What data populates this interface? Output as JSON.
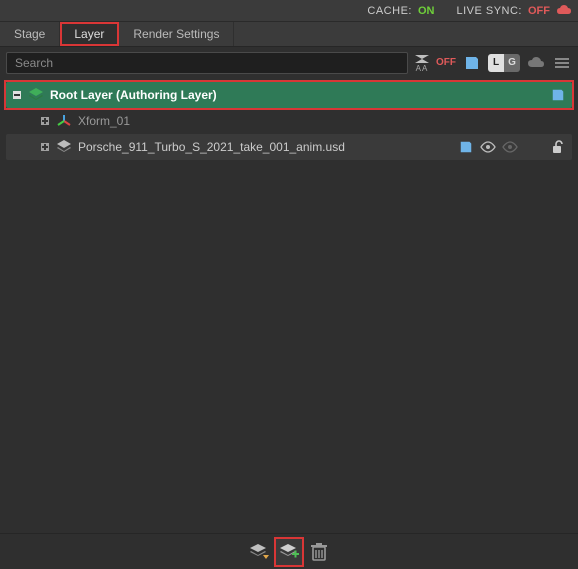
{
  "statusbar": {
    "cache_label": "CACHE:",
    "cache_status": "ON",
    "livesync_label": "LIVE SYNC:",
    "livesync_status": "OFF"
  },
  "tabs": [
    {
      "label": "Stage",
      "active": false
    },
    {
      "label": "Layer",
      "active": true,
      "highlighted": true
    },
    {
      "label": "Render Settings",
      "active": false
    }
  ],
  "toolbar": {
    "search_placeholder": "Search",
    "aa_label": "AA",
    "off_label": "OFF",
    "lg": [
      "L",
      "G"
    ]
  },
  "tree": {
    "root": {
      "label": "Root Layer (Authoring Layer)",
      "expanded": true,
      "highlighted": true,
      "actions": [
        "save"
      ]
    },
    "children": [
      {
        "label": "Xform_01",
        "icon": "xform-axis",
        "expanded": false
      },
      {
        "label": "Porsche_911_Turbo_S_2021_take_001_anim.usd",
        "icon": "layers",
        "expanded": false,
        "actions": [
          "save",
          "visibility-on",
          "visibility-dim",
          "lock-open"
        ]
      }
    ]
  },
  "bottombar": {
    "buttons": [
      {
        "name": "import-layer"
      },
      {
        "name": "create-sublayer",
        "highlighted": true
      },
      {
        "name": "delete-layer"
      }
    ]
  },
  "colors": {
    "accent_green": "#2f7a57",
    "highlight_red": "#d93636",
    "status_on": "#6fcf3a",
    "status_off": "#e05a5a",
    "save_blue": "#6fb4e8"
  }
}
